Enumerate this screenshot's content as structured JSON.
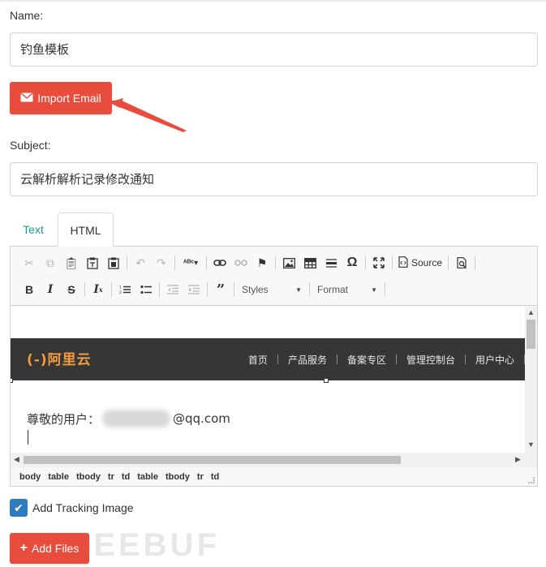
{
  "form": {
    "name_label": "Name:",
    "name_value": "钓鱼模板",
    "import_email_label": "Import Email",
    "subject_label": "Subject:",
    "subject_value": "云解析解析记录修改通知"
  },
  "tabs": [
    {
      "label": "Text",
      "active": false
    },
    {
      "label": "HTML",
      "active": true
    }
  ],
  "toolbar": {
    "source_label": "Source",
    "styles_label": "Styles",
    "format_label": "Format"
  },
  "email_content": {
    "logo_text": "(-)阿里云",
    "nav": [
      "首页",
      "产品服务",
      "备案专区",
      "管理控制台",
      "用户中心"
    ],
    "greeting_prefix": "尊敬的用户：",
    "greeting_suffix": "@qq.com"
  },
  "path": [
    "body",
    "table",
    "tbody",
    "tr",
    "td",
    "table",
    "tbody",
    "tr",
    "td"
  ],
  "tracking": {
    "label": "Add Tracking Image",
    "checked": true
  },
  "add_files_label": "Add Files",
  "watermark": "FREEBUF",
  "colors": {
    "accent_red": "#e74c3c",
    "tab_teal": "#16a085",
    "checkbox_blue": "#2e7bbf",
    "banner_dark": "#363636",
    "logo_orange": "#f29c3e"
  }
}
